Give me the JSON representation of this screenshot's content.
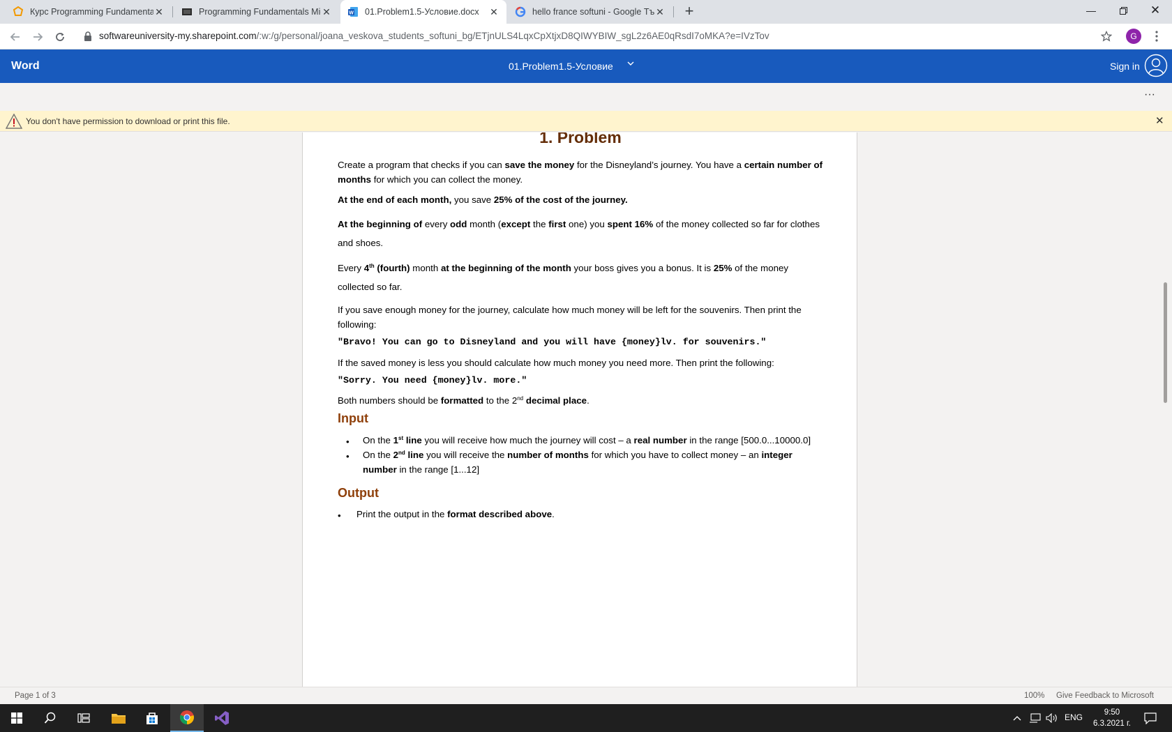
{
  "browser": {
    "tabs": [
      {
        "label": "Курс Programming Fundamentals",
        "icon": "softuni-icon",
        "active": false
      },
      {
        "label": "Programming Fundamentals Mid",
        "icon": "video-icon",
        "active": false
      },
      {
        "label": "01.Problem1.5-Условие.docx",
        "icon": "word-icon",
        "active": true
      },
      {
        "label": "hello france softuni - Google Търсене",
        "icon": "google-icon",
        "active": false
      }
    ],
    "url_host": "softwareuniversity-my.sharepoint.com",
    "url_path": "/:w:/g/personal/joana_veskova_students_softuni_bg/ETjnULS4LqxCpXtjxD8QIWYBIW_sgL2z6AE0qRsdI7oMKA?e=IVzTov",
    "profile_initial": "G"
  },
  "word": {
    "app_name": "Word",
    "doc_title": "01.Problem1.5-Условие",
    "sign_in": "Sign in",
    "more": "···",
    "warning": "You don't have permission to download or print this file."
  },
  "document": {
    "heading": "1. Problem",
    "input_heading": "Input",
    "output_heading": "Output",
    "code_bravo": "\"Bravo! You can go to Disneyland and you will have {money}lv. for souvenirs.\"",
    "code_sorry": "\"Sorry. You need {money}lv. more.\""
  },
  "status": {
    "page": "Page 1 of 3",
    "zoom": "100%",
    "feedback": "Give Feedback to Microsoft"
  },
  "taskbar": {
    "lang": "ENG",
    "time": "9:50",
    "date": "6.3.2021 г."
  },
  "colors": {
    "word_blue": "#185abd",
    "heading": "#642d08",
    "subheading": "#8f400b",
    "warning_bg": "#fff4ce"
  }
}
